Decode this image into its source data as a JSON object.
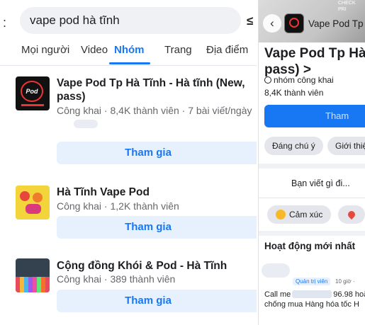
{
  "left": {
    "search": {
      "value": "vape pod hà tĩnh"
    },
    "tabs": [
      {
        "label": "Mọi người"
      },
      {
        "label": "Video"
      },
      {
        "label": "Nhóm",
        "active": true
      },
      {
        "label": "Trang"
      },
      {
        "label": "Địa điểm"
      }
    ],
    "results": [
      {
        "title_line1": "Vape Pod Tp Hà Tĩnh - Hà tĩnh (New,",
        "title_line2": "pass)",
        "meta": "Công khai · 8,4K thành viên · 7 bài viết/ngày",
        "thumb_text": "Pod",
        "join": "Tham gia"
      },
      {
        "title_line1": "Hà Tĩnh Vape Pod",
        "meta": "Công khai · 1,2K thành viên",
        "join": "Tham gia"
      },
      {
        "title_line1": "Cộng đồng Khói & Pod - Hà Tĩnh",
        "meta": "Công khai · 389 thành viên",
        "join": "Tham gia"
      }
    ]
  },
  "right": {
    "header_name": "Vape Pod Tp",
    "cover_text_1": "CHECK",
    "cover_text_2": "PRI",
    "title_line1": "Vape Pod Tp Hà T",
    "title_line2": "pass)",
    "title_chevron": ">",
    "group_type": "nhóm công khai",
    "members": "8,4K thành viên",
    "join_button": "Tham",
    "chip_1": "Đáng chú ý",
    "chip_2": "Giới thiệ",
    "composer_placeholder": "Bạn viết gì đi...",
    "action_feeling": "Cảm xúc",
    "section_title": "Hoạt động mới nhất",
    "admin_badge": "Quản trị viên",
    "post_time": "10 giờ ·",
    "post_line1_a": "Call me",
    "post_line1_b": "96.98 hoặ",
    "post_line2": "chống mua Hàng hóa tốc H"
  }
}
